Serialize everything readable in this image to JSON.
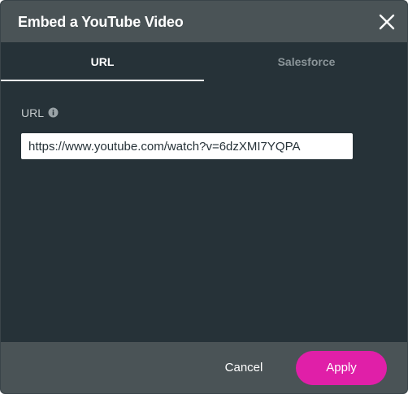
{
  "dialog": {
    "title": "Embed a YouTube Video",
    "close_icon": "close-icon"
  },
  "tabs": [
    {
      "label": "URL",
      "active": true
    },
    {
      "label": "Salesforce",
      "active": false
    }
  ],
  "url_field": {
    "label": "URL",
    "info_icon": "info-icon",
    "value": "https://www.youtube.com/watch?v=6dzXMI7YQPA"
  },
  "footer": {
    "cancel_label": "Cancel",
    "apply_label": "Apply"
  },
  "colors": {
    "background": "#263238",
    "header": "#4a5356",
    "accent": "#e01fa8",
    "inactive_tab_text": "#8b9599"
  }
}
